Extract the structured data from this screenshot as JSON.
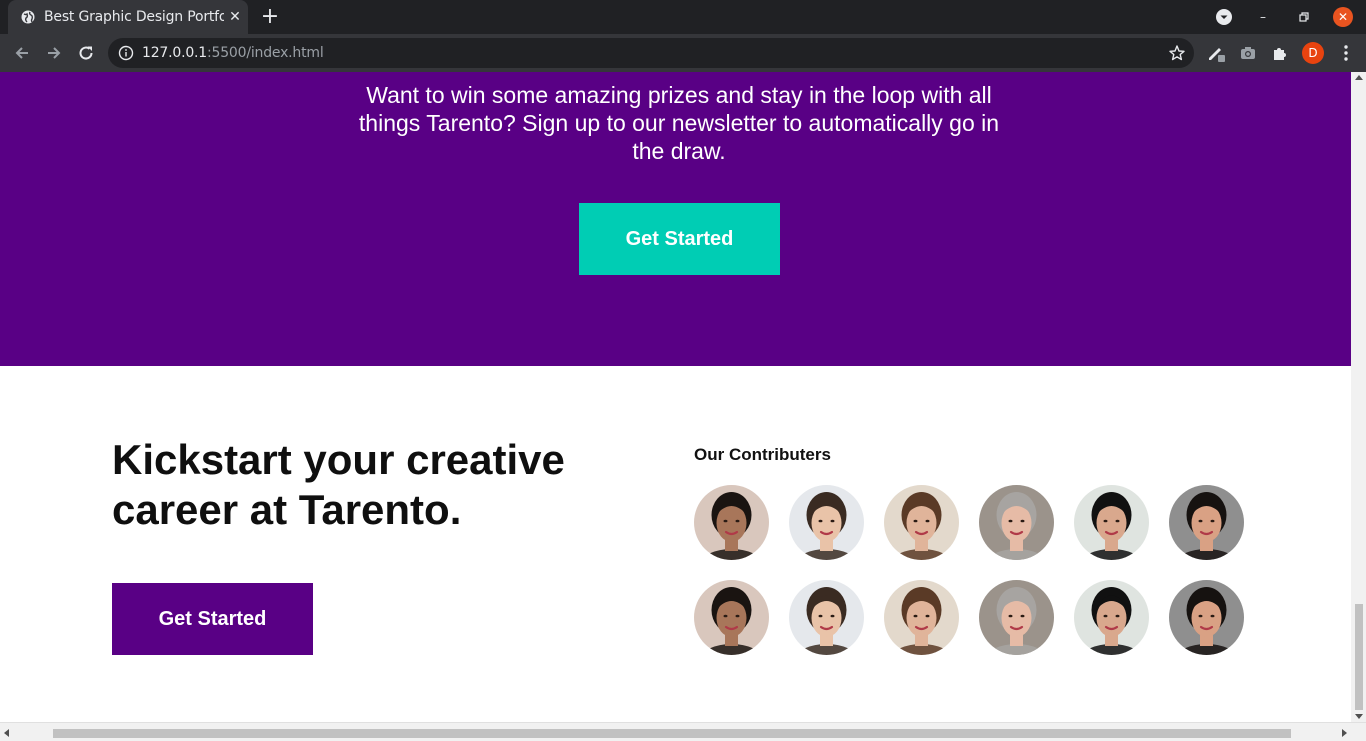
{
  "browser": {
    "tab_title": "Best Graphic Design Portfolio",
    "tab_close": "✕",
    "new_tab": "+",
    "url_host": "127.0.0.1",
    "url_path": ":5500/index.html",
    "profile_initial": "D",
    "window_min": "–",
    "window_close": "✕",
    "icons": [
      "globe-icon",
      "back-icon",
      "forward-icon",
      "reload-icon",
      "info-icon",
      "star-icon",
      "edit-icon",
      "camera-icon",
      "extensions-icon",
      "menu-icon"
    ]
  },
  "promo": {
    "text": "Want to win some amazing prizes and stay in the loop with all things Tarento? Sign up to our newsletter to automatically go in the draw.",
    "button_label": "Get Started",
    "background": "#590085",
    "button_color": "#00cdb4"
  },
  "kickstart": {
    "title": "Kickstart your creative career at Tarento.",
    "button_label": "Get Started",
    "button_color": "#590085"
  },
  "contributors": {
    "heading": "Our Contributers",
    "faces": [
      {
        "bg": "#d9c7bd",
        "skin": "#a8765a",
        "hair": "#1a1411"
      },
      {
        "bg": "#e5e8ec",
        "skin": "#e9c3a8",
        "hair": "#3a2b22"
      },
      {
        "bg": "#e3d9cc",
        "skin": "#e0b49a",
        "hair": "#5a3a26"
      },
      {
        "bg": "#9b938b",
        "skin": "#e6bba6",
        "hair": "#a7a4a1"
      },
      {
        "bg": "#dfe4e0",
        "skin": "#d9a88d",
        "hair": "#111111"
      },
      {
        "bg": "#8f8f8f",
        "skin": "#d9a184",
        "hair": "#161210"
      },
      {
        "bg": "#d9c7bd",
        "skin": "#a8765a",
        "hair": "#1a1411"
      },
      {
        "bg": "#e5e8ec",
        "skin": "#e9c3a8",
        "hair": "#3a2b22"
      },
      {
        "bg": "#e3d9cc",
        "skin": "#e0b49a",
        "hair": "#5a3a26"
      },
      {
        "bg": "#9b938b",
        "skin": "#e6bba6",
        "hair": "#a7a4a1"
      },
      {
        "bg": "#dfe4e0",
        "skin": "#d9a88d",
        "hair": "#111111"
      },
      {
        "bg": "#8f8f8f",
        "skin": "#d9a184",
        "hair": "#161210"
      }
    ]
  }
}
